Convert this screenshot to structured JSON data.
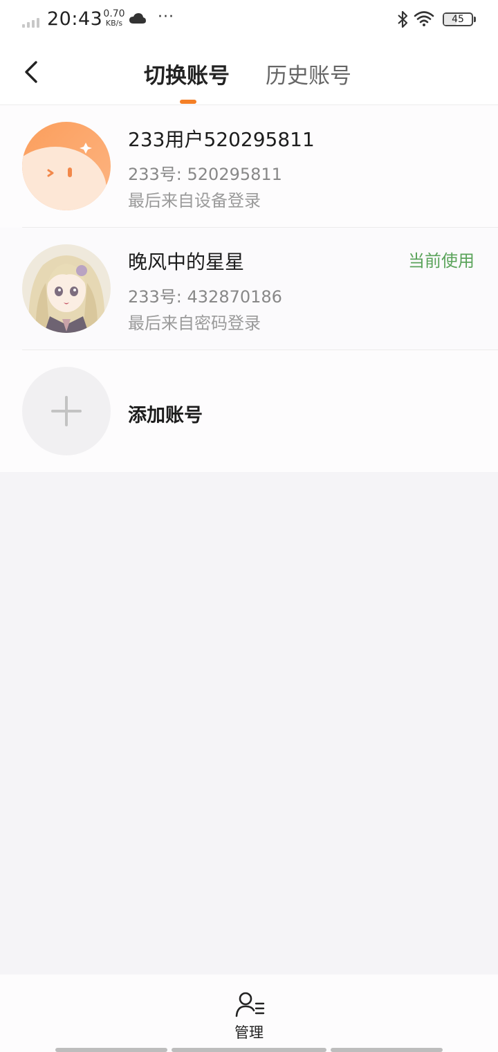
{
  "status_bar": {
    "time": "20:43",
    "net_speed_value": "0.70",
    "net_speed_unit": "KB/s",
    "more": "···",
    "battery": "45",
    "icons": [
      "signal-icon",
      "cloud-icon",
      "bluetooth-icon",
      "wifi-icon",
      "battery-icon"
    ]
  },
  "header": {
    "back_icon": "chevron-left-icon",
    "tabs": [
      {
        "label": "切换账号",
        "active": true
      },
      {
        "label": "历史账号",
        "active": false
      }
    ],
    "accent_color": "#f47f26"
  },
  "accounts": [
    {
      "name": "233用户520295811",
      "id_text": "233号: 520295811",
      "last_login": "最后来自设备登录",
      "avatar": "default-orange-avatar"
    },
    {
      "name": "晚风中的星星",
      "id_text": "233号: 432870186",
      "last_login": "最后来自密码登录",
      "badge": "当前使用",
      "avatar": "anime-girl-avatar"
    }
  ],
  "add_account": {
    "label": "添加账号",
    "icon": "plus-icon"
  },
  "bottom_bar": {
    "manage_label": "管理",
    "manage_icon": "user-list-icon"
  },
  "colors": {
    "badge_green": "#5aa35a",
    "background": "#f5f4f7"
  }
}
